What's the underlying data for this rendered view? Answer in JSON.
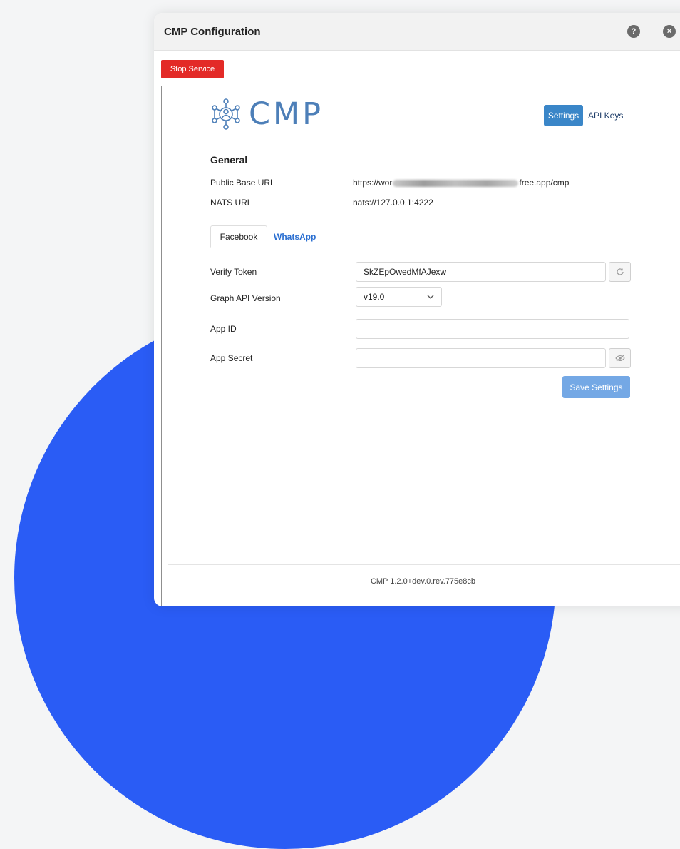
{
  "window": {
    "title": "CMP Configuration"
  },
  "toolbar": {
    "stop_service_label": "Stop Service"
  },
  "logo": {
    "text": "CMP"
  },
  "nav": {
    "settings_label": "Settings",
    "api_keys_label": "API Keys"
  },
  "general": {
    "heading": "General",
    "public_base_url_label": "Public Base URL",
    "public_base_url_prefix": "https://wor",
    "public_base_url_suffix": "free.app/cmp",
    "nats_url_label": "NATS URL",
    "nats_url_value": "nats://127.0.0.1:4222"
  },
  "tabs": {
    "facebook": "Facebook",
    "whatsapp": "WhatsApp"
  },
  "form": {
    "verify_token_label": "Verify Token",
    "verify_token_value": "SkZEpOwedMfAJexw",
    "graph_api_version_label": "Graph API Version",
    "graph_api_version_value": "v19.0",
    "app_id_label": "App ID",
    "app_id_value": "",
    "app_secret_label": "App Secret",
    "app_secret_value": "",
    "save_label": "Save Settings"
  },
  "footer": {
    "version": "CMP 1.2.0+dev.0.rev.775e8cb"
  },
  "colors": {
    "accent": "#3a86c8",
    "danger": "#e32a27",
    "link": "#2b6fd1",
    "background_blob": "#2a5cf5"
  },
  "icons": {
    "help": "help-icon",
    "close": "close-icon",
    "refresh": "refresh-icon",
    "eye": "eye-icon",
    "chevron": "chevron-down-icon",
    "logo": "cmp-network-logo-icon"
  }
}
